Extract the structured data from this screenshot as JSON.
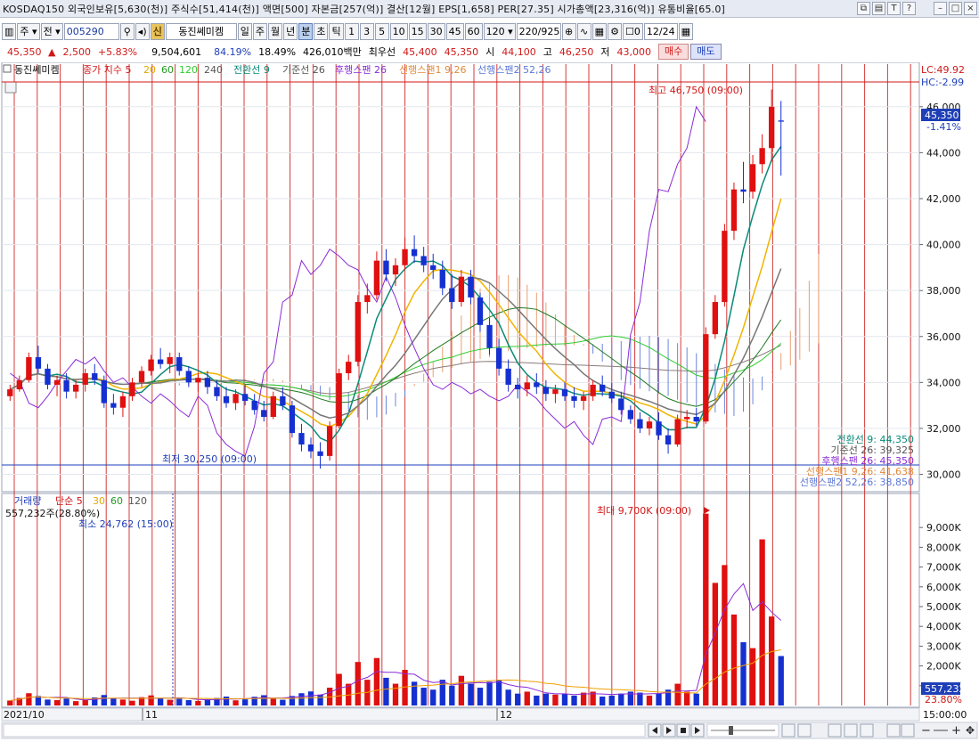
{
  "window": {
    "title": "KOSDAQ150 외국인보유[5,630(천)] 주식수[51,414(천)] 액면[500] 자본금[257(억)] 결산[12월] EPS[1,658] PER[27.35] 시가총액[23,316(억)] 유통비율[65.0]",
    "icons": [
      "restore-icon",
      "copy-icon",
      "font-size-icon",
      "help-icon",
      "minimize-icon",
      "maximize-icon",
      "close-icon"
    ]
  },
  "toolbar": {
    "period_label": "주",
    "type_label": "전",
    "code": "005290",
    "shin": "신",
    "name": "동진쎄미켐",
    "periods": [
      "일",
      "주",
      "월",
      "년",
      "분",
      "초",
      "틱"
    ],
    "selected_period": "분",
    "minutes": [
      "1",
      "3",
      "5",
      "10",
      "15",
      "30",
      "45",
      "60",
      "120"
    ],
    "count": "220",
    "total": "925",
    "d_label": "0",
    "date": "12/24"
  },
  "price": {
    "last": "45,350",
    "change": "2,500",
    "rate": "+5.83%",
    "volume": "9,504,601",
    "ratio1": "84.19%",
    "ratio2": "18.49%",
    "amount": "426,010백만",
    "best_label": "최우선",
    "ask": "45,400",
    "bid": "45,350",
    "open_label": "시",
    "open": "44,100",
    "high_label": "고",
    "high": "46,250",
    "low_label": "저",
    "low": "43,000",
    "buy_label": "매수",
    "sell_label": "매도"
  },
  "legend": {
    "name": "동진쎄미켐",
    "ma_label": "종가 지수 5",
    "ma20": "20",
    "ma60": "60",
    "ma120": "120",
    "ma240": "240",
    "conv": "전환선 9",
    "base": "기준선 26",
    "lag": "후행스팬 26",
    "lead1": "선행스팬1 9,26",
    "lead2": "선행스팬2 52,26"
  },
  "price_panel": {
    "lc": "LC:49.92",
    "hc": "HC:-2.99",
    "high_note": "최고 46,750 (09:00)",
    "low_note": "최저 30,250 (09:00)",
    "current": "45,350",
    "current_rate": "-1.41%",
    "yticks": [
      "46,000",
      "44,000",
      "42,000",
      "40,000",
      "38,000",
      "36,000",
      "34,000",
      "32,000",
      "30,000"
    ],
    "ichimoku_values": [
      {
        "label": "전환선 9: 44,350",
        "color": "#0a8a78"
      },
      {
        "label": "기준선 26: 39,325",
        "color": "#555555"
      },
      {
        "label": "후행스팬 26: 45,350",
        "color": "#8a2bd6"
      },
      {
        "label": "선행스팬1 9,26: 41,638",
        "color": "#e08a3c"
      },
      {
        "label": "선행스팬2 52,26: 38,850",
        "color": "#5c78d6"
      }
    ]
  },
  "volume_panel": {
    "legend_vol": "거래량",
    "legend_ma": "단순 5",
    "ma30": "30",
    "ma60": "60",
    "ma120": "120",
    "current_vol": "557,232주(28.80%)",
    "min_note": "최소 24,762 (15:00)",
    "max_note": "최대 9,700K (09:00)",
    "yticks": [
      "9,000K",
      "8,000K",
      "7,000K",
      "6,000K",
      "5,000K",
      "4,000K",
      "3,000K",
      "2,000K",
      "1,000K"
    ],
    "current_tag": "557,232",
    "current_rate": "23.80%"
  },
  "xaxis": {
    "labels": [
      "2021/10",
      "11",
      "12"
    ],
    "time": "15:00:00"
  },
  "colors": {
    "up": "#e01010",
    "down": "#1530d0",
    "grid_red": "#cc1a1a"
  },
  "chart_data": {
    "type": "candlestick",
    "unit": "KRW",
    "ylim": [
      29400,
      47000
    ],
    "candles": [
      [
        33400,
        33900,
        33200,
        33700
      ],
      [
        33700,
        34300,
        33600,
        34100
      ],
      [
        34100,
        35300,
        34000,
        35100
      ],
      [
        35100,
        35600,
        34400,
        34600
      ],
      [
        34600,
        34800,
        33700,
        33900
      ],
      [
        33900,
        34300,
        33400,
        34100
      ],
      [
        34100,
        34400,
        33300,
        33600
      ],
      [
        33600,
        34100,
        33300,
        33900
      ],
      [
        33900,
        34600,
        33600,
        34400
      ],
      [
        34400,
        34800,
        33900,
        34100
      ],
      [
        34100,
        34300,
        32900,
        33100
      ],
      [
        33100,
        33500,
        32600,
        32900
      ],
      [
        32900,
        33600,
        32500,
        33400
      ],
      [
        33400,
        34200,
        33200,
        34000
      ],
      [
        34000,
        34700,
        33800,
        34500
      ],
      [
        34500,
        35200,
        34300,
        35000
      ],
      [
        35000,
        35500,
        34600,
        34800
      ],
      [
        34800,
        35300,
        34400,
        35100
      ],
      [
        35100,
        35300,
        34300,
        34500
      ],
      [
        34500,
        34700,
        33800,
        34000
      ],
      [
        34000,
        34400,
        33600,
        34200
      ],
      [
        34200,
        34500,
        33500,
        33800
      ],
      [
        33800,
        34100,
        33200,
        33400
      ],
      [
        33400,
        33800,
        32900,
        33100
      ],
      [
        33100,
        33700,
        32800,
        33500
      ],
      [
        33500,
        33900,
        33000,
        33200
      ],
      [
        33200,
        33500,
        32600,
        32800
      ],
      [
        32800,
        33200,
        32300,
        32500
      ],
      [
        32500,
        33600,
        32400,
        33400
      ],
      [
        33400,
        33800,
        32800,
        33000
      ],
      [
        33000,
        33200,
        31600,
        31800
      ],
      [
        31800,
        32200,
        31000,
        31300
      ],
      [
        31300,
        31600,
        30700,
        31000
      ],
      [
        31000,
        31400,
        30250,
        30800
      ],
      [
        30800,
        32300,
        30600,
        32100
      ],
      [
        32100,
        34600,
        32000,
        34400
      ],
      [
        34400,
        35200,
        34100,
        34900
      ],
      [
        34900,
        37800,
        34700,
        37500
      ],
      [
        37500,
        38300,
        37000,
        37800
      ],
      [
        37800,
        39700,
        37600,
        39300
      ],
      [
        39300,
        39800,
        38400,
        38700
      ],
      [
        38700,
        39400,
        38200,
        39100
      ],
      [
        39100,
        40300,
        38900,
        39800
      ],
      [
        39800,
        40400,
        39200,
        39500
      ],
      [
        39500,
        39900,
        38800,
        39100
      ],
      [
        39100,
        39600,
        38500,
        38900
      ],
      [
        38900,
        39300,
        37800,
        38100
      ],
      [
        38100,
        38700,
        37200,
        37500
      ],
      [
        37500,
        38900,
        37300,
        38600
      ],
      [
        38600,
        38900,
        37400,
        37700
      ],
      [
        37700,
        37900,
        36200,
        36500
      ],
      [
        36500,
        36800,
        35200,
        35500
      ],
      [
        35500,
        35900,
        34300,
        34600
      ],
      [
        34600,
        35000,
        33600,
        33900
      ],
      [
        33900,
        34200,
        33300,
        33700
      ],
      [
        33700,
        34300,
        33400,
        34000
      ],
      [
        34000,
        34400,
        33500,
        33800
      ],
      [
        33800,
        34100,
        33200,
        33500
      ],
      [
        33500,
        33900,
        33100,
        33700
      ],
      [
        33700,
        34000,
        33200,
        33400
      ],
      [
        33400,
        33800,
        32900,
        33200
      ],
      [
        33200,
        33600,
        32800,
        33400
      ],
      [
        33400,
        34100,
        33200,
        33900
      ],
      [
        33900,
        34300,
        33400,
        33600
      ],
      [
        33600,
        34000,
        33100,
        33300
      ],
      [
        33300,
        33600,
        32600,
        32800
      ],
      [
        32800,
        33000,
        32200,
        32400
      ],
      [
        32400,
        32700,
        31800,
        32000
      ],
      [
        32000,
        32500,
        31700,
        32300
      ],
      [
        32300,
        32700,
        31500,
        31700
      ],
      [
        31700,
        32000,
        30900,
        31300
      ],
      [
        31300,
        32600,
        31200,
        32400
      ],
      [
        32400,
        32800,
        32000,
        32500
      ],
      [
        32500,
        32900,
        32100,
        32300
      ],
      [
        32300,
        36400,
        32200,
        36100
      ],
      [
        36100,
        37800,
        35900,
        37500
      ],
      [
        37500,
        40900,
        37300,
        40600
      ],
      [
        40600,
        42700,
        40200,
        42400
      ],
      [
        42400,
        43600,
        41800,
        42300
      ],
      [
        42300,
        43900,
        42000,
        43500
      ],
      [
        43500,
        44800,
        43100,
        44200
      ],
      [
        44200,
        46750,
        43600,
        46000
      ],
      [
        45400,
        46250,
        43000,
        45350
      ]
    ],
    "volume_k": [
      250,
      380,
      620,
      480,
      300,
      270,
      350,
      220,
      290,
      410,
      530,
      360,
      300,
      240,
      420,
      510,
      380,
      290,
      340,
      270,
      230,
      320,
      380,
      450,
      260,
      310,
      440,
      520,
      350,
      290,
      480,
      620,
      710,
      550,
      900,
      1600,
      1100,
      2200,
      1300,
      2400,
      1400,
      1100,
      1800,
      1200,
      900,
      800,
      1300,
      1000,
      1500,
      1100,
      900,
      1200,
      1300,
      800,
      600,
      700,
      500,
      600,
      550,
      600,
      500,
      650,
      700,
      450,
      500,
      600,
      700,
      650,
      500,
      600,
      800,
      1100,
      700,
      600,
      9700,
      6200,
      7100,
      4600,
      3200,
      2900,
      8400,
      4500,
      2500
    ]
  }
}
